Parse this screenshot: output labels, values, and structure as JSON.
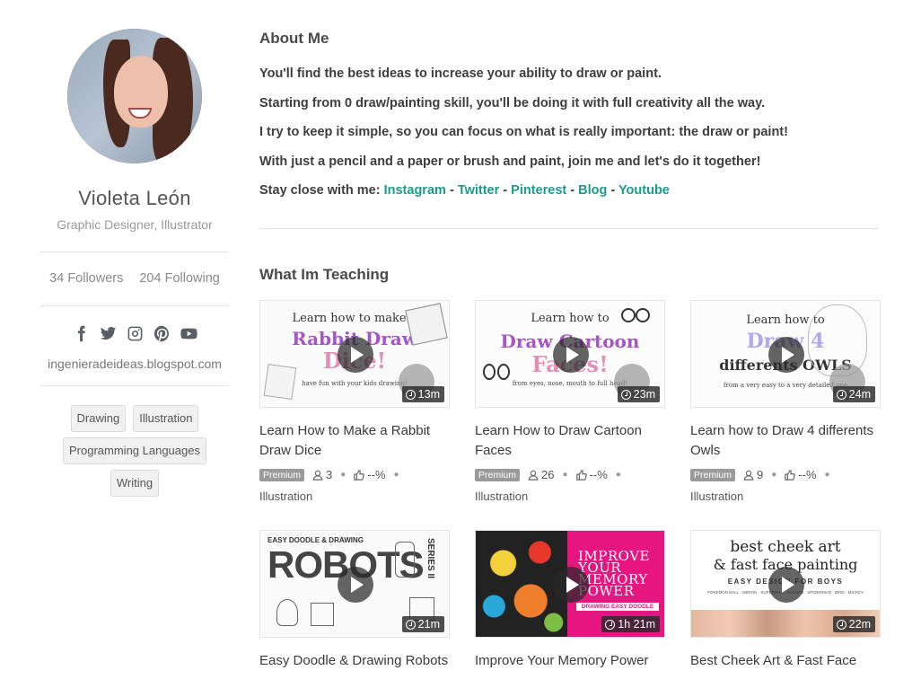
{
  "profile": {
    "name": "Violeta León",
    "title": "Graphic Designer, Illustrator",
    "followers": "34 Followers",
    "following": "204 Following",
    "socials": [
      "facebook-icon",
      "twitter-icon",
      "instagram-icon",
      "pinterest-icon",
      "youtube-icon"
    ],
    "website": "ingenieradeideas.blogspot.com",
    "tags": [
      "Drawing",
      "Illustration",
      "Programming Languages",
      "Writing"
    ]
  },
  "about": {
    "heading": "About Me",
    "lines": [
      "You'll find the best ideas to increase your ability to draw or paint.",
      "Starting from 0 draw/painting skill, you'll be doing it with full creativity all the way.",
      "I try to keep it simple, so you can focus on what is really important: the draw or paint!",
      "With just a pencil and a paper or brush and paint, join me and let's do it together!"
    ],
    "stay_prefix": "Stay close with me: ",
    "links": [
      "Instagram",
      "Twitter",
      "Pinterest",
      "Blog",
      "Youtube"
    ],
    "link_separator": " - ",
    "link_color": "#1a9c8c"
  },
  "teaching": {
    "heading": "What Im Teaching",
    "courses": [
      {
        "title": "Learn How to Make a Rabbit Draw Dice",
        "duration": "13m",
        "badge": "Premium",
        "students": "3",
        "rating": "--%",
        "category": "Illustration",
        "thumb_lines": [
          "Learn how to make a",
          "Rabbit Draw",
          "Dice!",
          "have fun with your kids drawing!"
        ]
      },
      {
        "title": "Learn How to Draw Cartoon Faces",
        "duration": "23m",
        "badge": "Premium",
        "students": "26",
        "rating": "--%",
        "category": "Illustration",
        "thumb_lines": [
          "Learn how to",
          "Draw Cartoon",
          "Faces!",
          "from eyes, nose, mouth to full head!"
        ]
      },
      {
        "title": "Learn how to Draw 4 differents Owls",
        "duration": "24m",
        "badge": "Premium",
        "students": "9",
        "rating": "--%",
        "category": "Illustration",
        "thumb_lines": [
          "Learn how to",
          "Draw 4",
          "differents OWLS",
          "from a very easy to a very detailed one"
        ]
      },
      {
        "title": "Easy Doodle & Drawing Robots",
        "duration": "21m",
        "thumb_lines": [
          "EASY DOODLE & DRAWING",
          "ROBOTS",
          "SERIES II"
        ]
      },
      {
        "title": "Improve Your Memory Power",
        "duration": "1h 21m",
        "thumb_lines": [
          "IMPROVE",
          "YOUR",
          "MEMORY",
          "POWER",
          "DRAWING EASY DOODLE"
        ]
      },
      {
        "title": "Best Cheek Art & Fast Face",
        "duration": "22m",
        "thumb_lines": [
          "best cheek art",
          "& fast face painting",
          "EASY DESIGN FOR BOYS",
          "POKEMON BALL · MINION · SUPERMAN · BATMAN · SPIDERMAN · BIRD · MICKEY"
        ]
      }
    ]
  }
}
